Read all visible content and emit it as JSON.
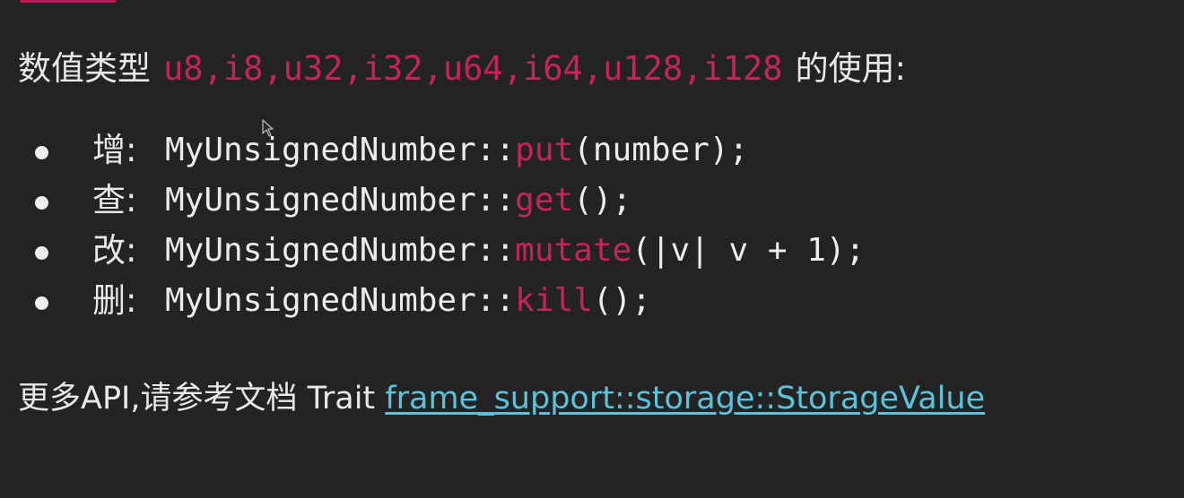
{
  "heading": {
    "prefix": "数值类型",
    "types": "u8,i8,u32,i32,u64,i64,u128,i128",
    "suffix": "的使用:"
  },
  "operations": [
    {
      "op": "增:",
      "target": "MyUnsignedNumber::",
      "method": "put",
      "args": "(number);"
    },
    {
      "op": "查:",
      "target": "MyUnsignedNumber::",
      "method": "get",
      "args": "();"
    },
    {
      "op": "改:",
      "target": "MyUnsignedNumber::",
      "method": "mutate",
      "args": "(|v| v + 1);"
    },
    {
      "op": "删:",
      "target": "MyUnsignedNumber::",
      "method": "kill",
      "args": "();"
    }
  ],
  "footer": {
    "prefix": "更多API,请参考文档 Trait ",
    "link": "frame_support::storage::StorageValue"
  },
  "colors": {
    "background": "#232323",
    "text": "#e8e8e8",
    "accent": "#c4245a",
    "link": "#5bc2dd"
  }
}
